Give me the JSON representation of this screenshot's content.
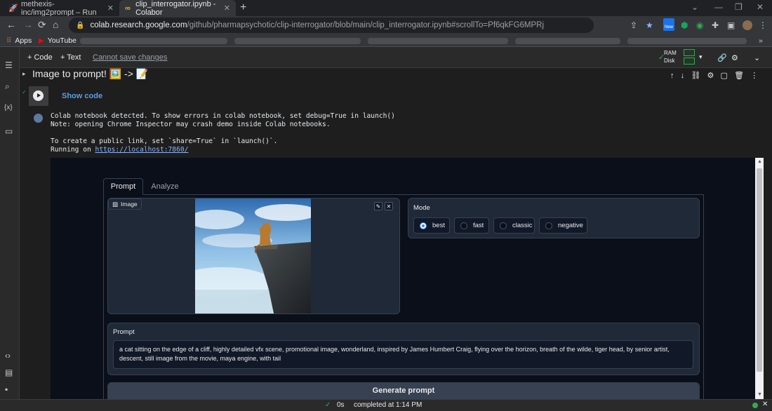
{
  "browser": {
    "tabs": [
      {
        "title": "methexis-inc/img2prompt – Run",
        "close": "✕"
      },
      {
        "title": "clip_interrogator.ipynb - Colabor",
        "close": "✕"
      }
    ],
    "new_tab": "+",
    "url_host": "colab.research.google.com",
    "url_path": "/github/pharmapsychotic/clip-interrogator/blob/main/clip_interrogator.ipynb#scrollTo=Pf6qkFG6MPRj",
    "new_badge": "New",
    "bookmarks": [
      {
        "label": "Apps",
        "icon": "apps-grid-icon"
      },
      {
        "label": "YouTube",
        "icon": "youtube-icon"
      }
    ]
  },
  "colab": {
    "toolbar": {
      "add_code": "+ Code",
      "add_text": "+ Text",
      "cant_save": "Cannot save changes",
      "ram": "RAM",
      "disk": "Disk"
    },
    "section_title": "Image to prompt! 🖼️ -> 📝",
    "cell": {
      "show_code": "Show code",
      "output_lines": [
        "Colab notebook detected. To show errors in colab notebook, set debug=True in launch()",
        "Note: opening Chrome Inspector may crash demo inside Colab notebooks.",
        "",
        "To create a public link, set `share=True` in `launch()`.",
        "Running on "
      ],
      "local_link": "https://localhost:7860/"
    },
    "status": {
      "elapsed": "0s",
      "completed": "completed at 1:14 PM"
    }
  },
  "gradio": {
    "tabs": [
      "Prompt",
      "Analyze"
    ],
    "image_label": "Image",
    "mode": {
      "label": "Mode",
      "options": [
        "best",
        "fast",
        "classic",
        "negative"
      ],
      "selected": "best"
    },
    "prompt": {
      "label": "Prompt",
      "value": "a cat sitting on the edge of a cliff, highly detailed vfx scene, promotional image, wonderland, inspired by James Humbert Craig, flying over the horizon, breath of the wilde, tiger head, by senior artist, descent, still image from the movie, maya engine, with tail"
    },
    "generate_button": "Generate prompt"
  }
}
